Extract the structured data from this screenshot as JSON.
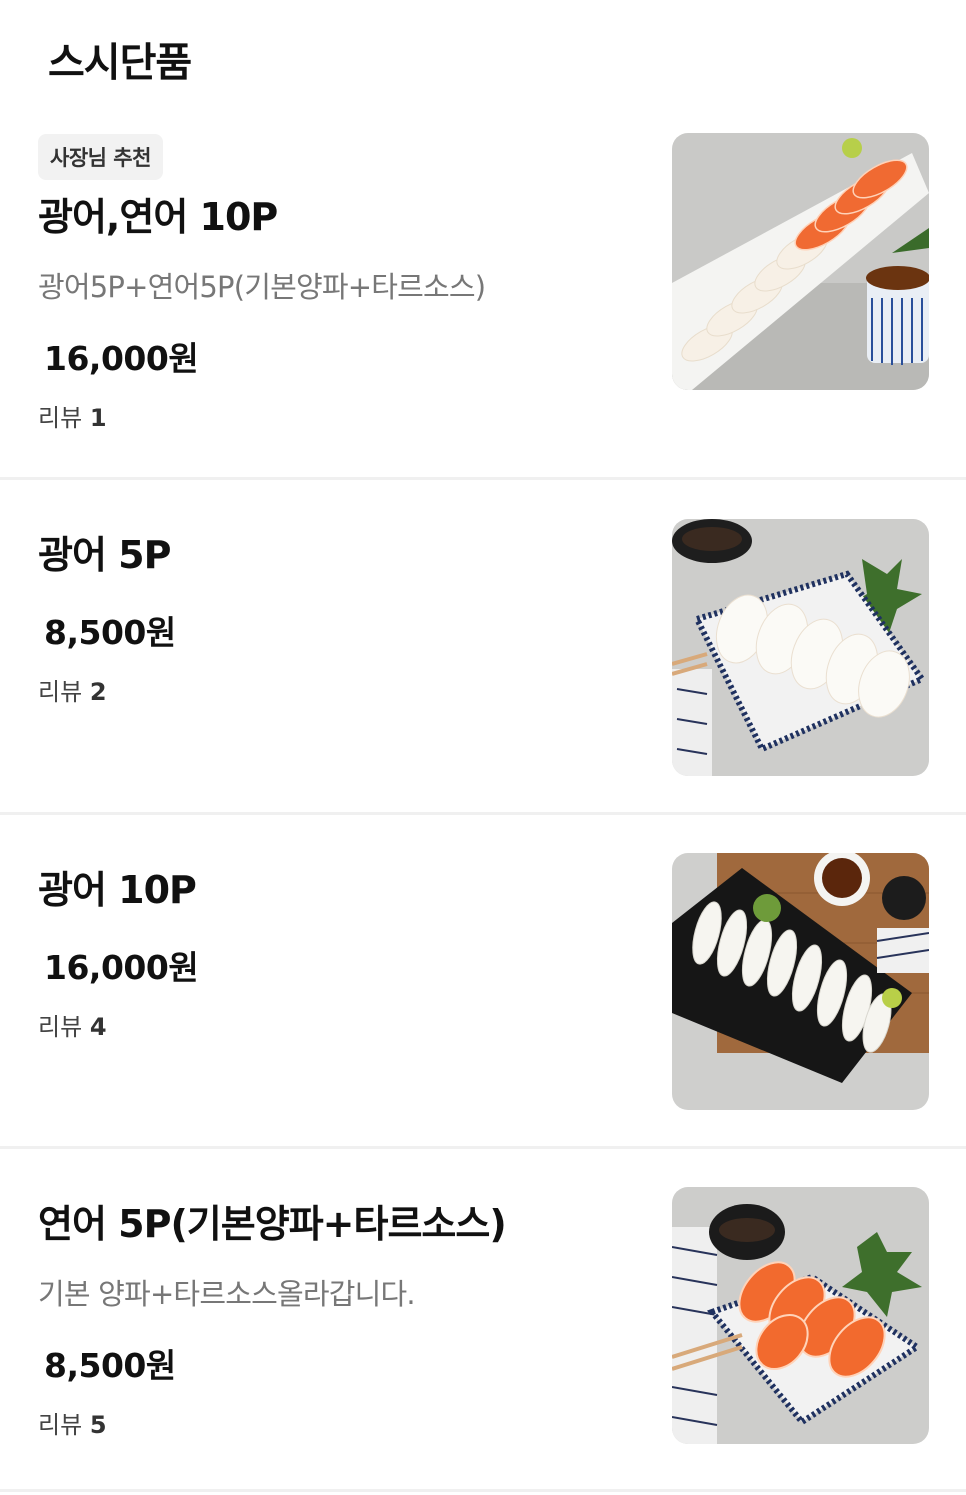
{
  "section": {
    "title": "스시단품"
  },
  "items": [
    {
      "badge": "사장님 추천",
      "name": "광어,연어 10P",
      "description": "광어5P+연어5P(기본양파+타르소스)",
      "price": "16,000원",
      "review_label": "리뷰",
      "review_count": "1",
      "image_icon": "flatfish-salmon-sushi-photo"
    },
    {
      "name": "광어 5P",
      "price": "8,500원",
      "review_label": "리뷰",
      "review_count": "2",
      "image_icon": "flatfish-sushi-photo"
    },
    {
      "name": "광어 10P",
      "price": "16,000원",
      "review_label": "리뷰",
      "review_count": "4",
      "image_icon": "flatfish-sushi-board-photo"
    },
    {
      "name": "연어 5P(기본양파+타르소스)",
      "description": "기본 양파+타르소스올라갑니다.",
      "price": "8,500원",
      "review_label": "리뷰",
      "review_count": "5",
      "image_icon": "salmon-sushi-photo"
    }
  ],
  "colors": {
    "background": "#ffffff",
    "divider": "#f0f0f0",
    "badge_bg": "#f2f2f2",
    "description": "#777777",
    "salmon": "#f06a32"
  }
}
